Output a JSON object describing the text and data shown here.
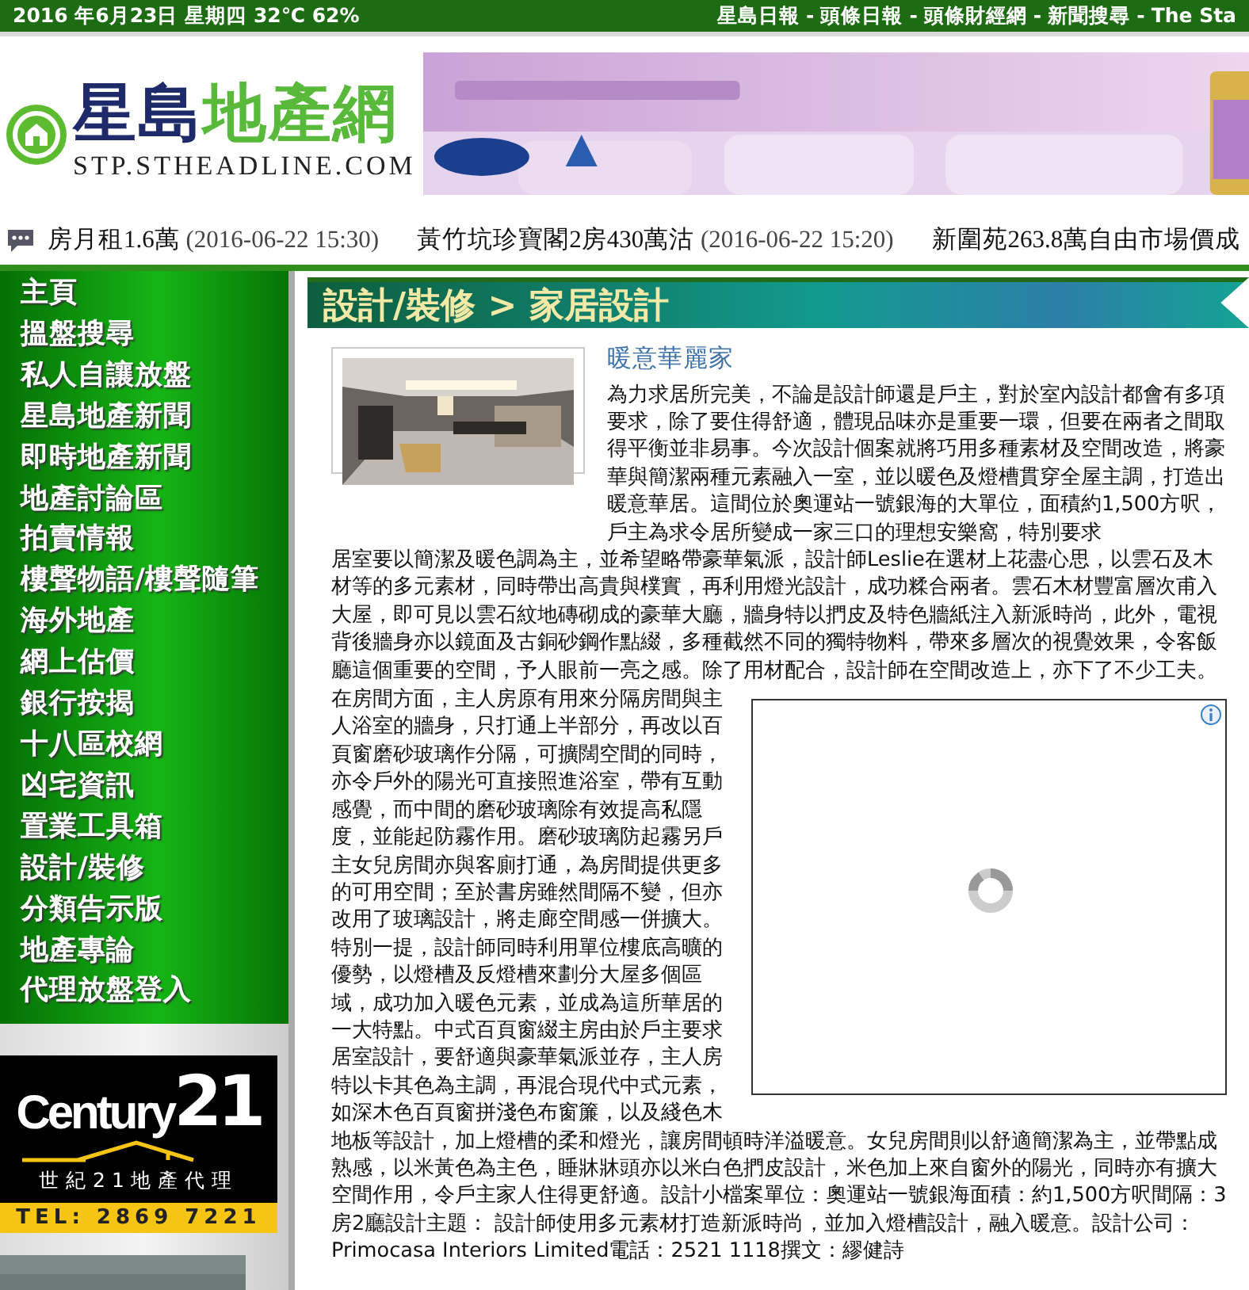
{
  "top_bar": {
    "date_weather": "2016 年6月23日 星期四 32℃ 62%",
    "separator": "-",
    "links": [
      "星島日報",
      "頭條日報",
      "頭條財經網",
      "新聞搜尋",
      "The Sta"
    ]
  },
  "logo": {
    "title_primary": "星島",
    "title_secondary": "地產網",
    "url": "STP.STHEADLINE.COM"
  },
  "ticker": [
    {
      "headline": "房月租1.6萬",
      "time": "(2016-06-22 15:30)"
    },
    {
      "headline": "黃竹坑珍寶閣2房430萬沽",
      "time": "(2016-06-22 15:20)"
    },
    {
      "headline": "新圍苑263.8萬自由市場價成"
    }
  ],
  "sidebar": {
    "items": [
      "主頁",
      "搵盤搜尋",
      "私人自讓放盤",
      "星島地產新聞",
      "即時地產新聞",
      "地產討論區",
      "拍賣情報",
      "樓聲物語/樓聲隨筆",
      "海外地產",
      "網上估價",
      "銀行按揭",
      "十八區校網",
      "凶宅資訊",
      "置業工具箱",
      "設計/裝修",
      "分類告示版",
      "地產專論",
      "代理放盤登入"
    ],
    "ad": {
      "brand": "Century",
      "brand_number": "21",
      "name": "世紀21地產代理",
      "phone": "TEL: 2869 7221"
    }
  },
  "section_header": "設計/裝修 > 家居設計",
  "article": {
    "title": "暖意華麗家",
    "intro_beside_image": "為力求居所完美，不論是設計師還是戶主，對於室內設計都會有多項要求，除了要住得舒適，體現品味亦是重要一環，但要在兩者之間取得平衡並非易事。今次設計個案就將巧用多種素材及空間改造，將豪華與簡潔兩種元素融入一室，並以暖色及燈槽貫穿全屋主調，打造出暖意華居。這間位於奧運站一號銀海的大單位，面積約1,500方呎，戶主為求令居所變成一家三口的理想安樂窩，特別要求",
    "intro_rest": "居室要以簡潔及暖色調為主，並希望略帶豪華氣派，設計師Leslie在選材上花盡心思，以雲石及木材等的多元素材，同時帶出高貴與樸實，再利用燈光設計，成功糅合兩者。雲石木材豐富層次甫入大屋，即可見以雲石紋地磚砌成的豪華大廳，牆身特以捫皮及特色牆紙注入新派時尚，此外，電視背後牆身亦以鏡面及古銅砂鋼作點綴，多種截然不同的獨特物料，帶來多層次的視覺效果，令客飯廳這個重要的空間，予人眼前一亮之感。除了用材配合，設計師在空間改造上，亦下了不少工夫。",
    "rooms_beside_ad": "在房間方面，主人房原有用來分隔房間與主人浴室的牆身，只打通上半部分，再改以百頁窗磨砂玻璃作分隔，可擴闊空間的同時，亦令戶外的陽光可直接照進浴室，帶有互動感覺，而中間的磨砂玻璃除有效提高私隱度，並能起防霧作用。磨砂玻璃防起霧另戶主女兒房間亦與客廁打通，為房間提供更多的可用空間；至於書房雖然間隔不變，但亦改用了玻璃設計，將走廊空間感一併擴大。特別一提，設計師同時利用單位樓底高曠的優勢，以燈槽及反燈槽來劃分大屋多個區域，成功加入暖色元素，並成為這所華居的一大特點。中式百頁窗綴主房由於戶主要求居室設計，要舒適與豪華氣派並存，主人房特以卡其色為主調，再混合現代中式元素，如深木色百頁窗拼淺色布窗簾，以及綫色木",
    "rooms_rest": "地板等設計，加上燈槽的柔和燈光，讓房間頓時洋溢暖意。女兒房間則以舒適簡潔為主，並帶點成熟感，以米黃色為主色，睡牀牀頭亦以米白色捫皮設計，米色加上來自窗外的陽光，同時亦有擴大空間作用，令戶主家人住得更舒適。設計小檔案單位：奧運站一號銀海面積：約1,500方呎間隔：3房2廳設計主題： 設計師使用多元素材打造新派時尚，並加入燈槽設計，融入暖意。設計公司：Primocasa Interiors Limited電話：2521 1118撰文：繆健詩"
  }
}
